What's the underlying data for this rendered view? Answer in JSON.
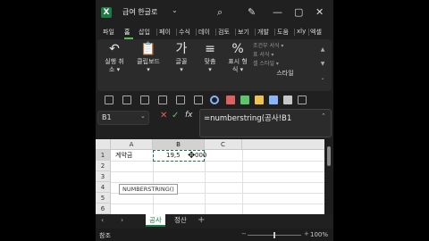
{
  "window": {
    "app_logo": "X",
    "title": "급여 한글로",
    "icons": [
      "chevron-down-icon",
      "search-icon",
      "pen-icon",
      "minimize-icon",
      "maximize-icon",
      "close-icon"
    ]
  },
  "ribbon_tabs": [
    "파일",
    "홈",
    "삽입",
    "페이",
    "수식",
    "데이",
    "검토",
    "보기",
    "개발",
    "도움",
    "xly",
    "엑셀"
  ],
  "ribbon": {
    "undo": {
      "label": "실행 취",
      "sub": "소 ▾"
    },
    "clipboard": {
      "label": "클립보드",
      "sub": "▾"
    },
    "font": {
      "label": "글꼴",
      "sub": "▾",
      "icon_text": "가"
    },
    "align": {
      "label": "맞춤",
      "sub": "▾"
    },
    "number": {
      "label": "표시 형",
      "sub": "식 ▾"
    },
    "styles": {
      "items": [
        "조건부 서식 ▾",
        "표 서식 ▾",
        "셀 스타일 ▾"
      ],
      "group_label": "스타일"
    }
  },
  "quick_toolbar_colors": [
    "#e06060",
    "#5ec46b",
    "#f0c24b",
    "#8ab4f8",
    "#c7c7c7"
  ],
  "formula_bar": {
    "name_box": "B1",
    "formula": "=numberstring(공사!B1",
    "fx_label": "fx"
  },
  "grid": {
    "columns": [
      "A",
      "B",
      "C"
    ],
    "rows": [
      "1",
      "2",
      "3",
      "4",
      "5",
      "6"
    ],
    "cells": {
      "A1": "계약금",
      "B1": "19,5",
      "B1_tail": "000"
    },
    "tooltip": "NUMBERSTRING()"
  },
  "sheets": {
    "tabs": [
      "공사",
      "정산"
    ],
    "active": "공사",
    "add_label": "+"
  },
  "status": {
    "mode": "참조",
    "zoom": "100%"
  }
}
